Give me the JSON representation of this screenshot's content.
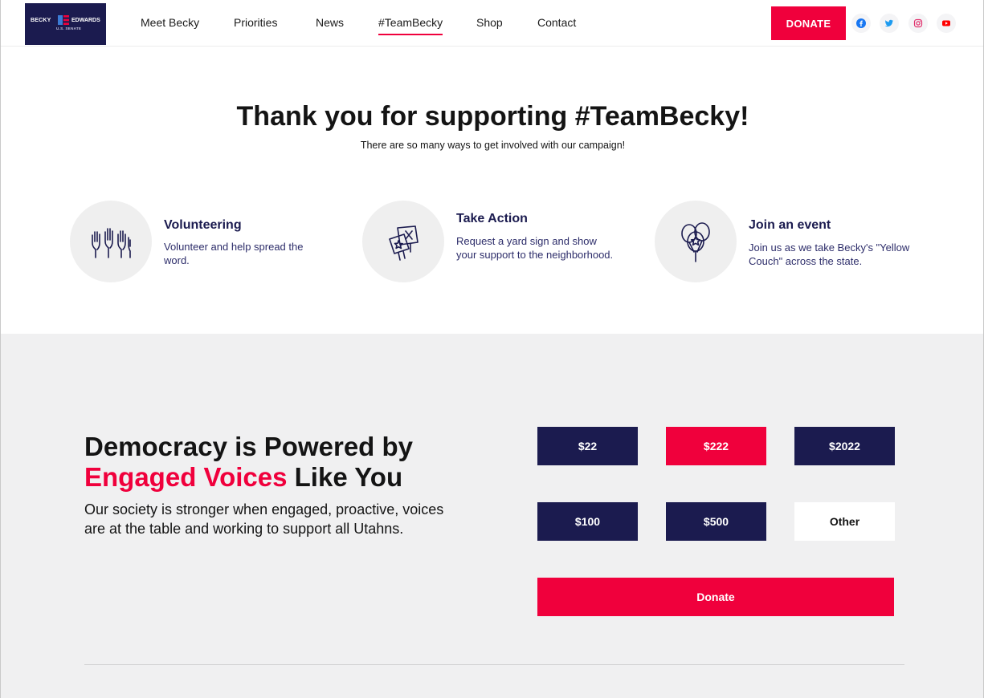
{
  "header": {
    "logo": {
      "left": "BECKY",
      "right": "EDWARDS",
      "tagline": "U.S. SENATE"
    },
    "nav": [
      {
        "label": "Meet Becky"
      },
      {
        "label": "Priorities"
      },
      {
        "label": "News"
      },
      {
        "label": "#TeamBecky",
        "active": true
      },
      {
        "label": "Shop"
      },
      {
        "label": "Contact"
      }
    ],
    "donate_label": "DONATE",
    "social": [
      "facebook-icon",
      "twitter-icon",
      "instagram-icon",
      "youtube-icon"
    ]
  },
  "hero": {
    "title": "Thank you for supporting #TeamBecky!",
    "subtitle": "There are so many ways to get involved with our campaign!"
  },
  "features": [
    {
      "icon": "raised-hands-icon",
      "title": "Volunteering",
      "text": "Volunteer and help spread the word."
    },
    {
      "icon": "yard-signs-icon",
      "title": "Take Action",
      "text": "Request a yard sign and show your support to the neighborhood."
    },
    {
      "icon": "balloons-icon",
      "title": "Join an event",
      "text": "Join us as we take Becky's \"Yellow Couch\" across the state."
    }
  ],
  "donate_section": {
    "headline_line1": "Democracy is Powered by",
    "headline_pink": "Engaged Voices",
    "headline_rest": " Like You",
    "paragraph": "Our society is stronger when engaged, proactive, voices are at the table and working to support all Utahns.",
    "amounts": [
      "$22",
      "$222",
      "$2022",
      "$100",
      "$500",
      "Other"
    ],
    "selected_amount": "$222",
    "donate_label": "Donate"
  },
  "colors": {
    "navy": "#1b1b4f",
    "accent": "#f0003c",
    "section_bg": "#f0f0f1"
  }
}
